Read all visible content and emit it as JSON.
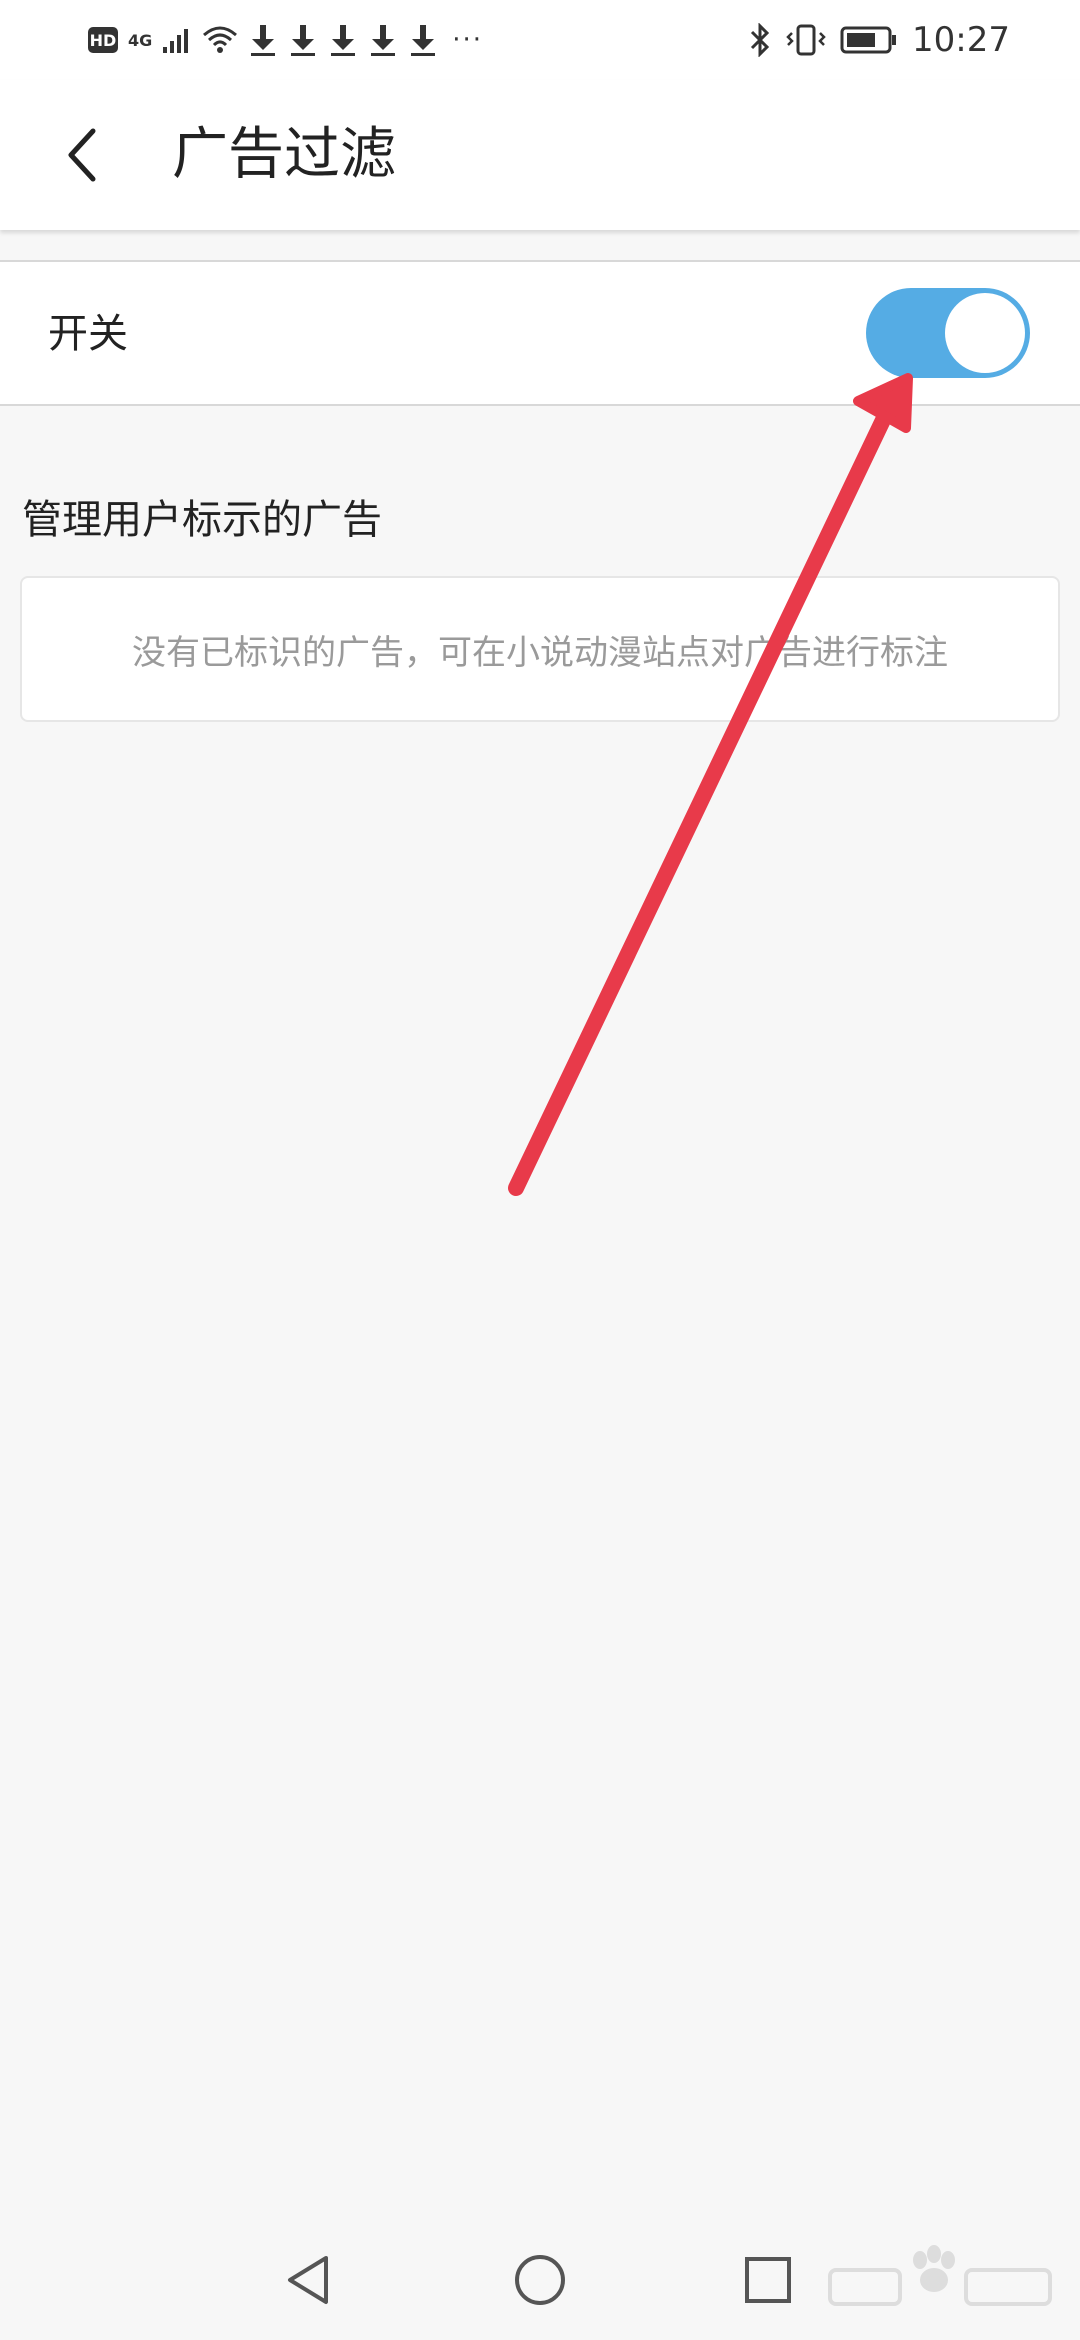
{
  "status_bar": {
    "hd_label": "HD",
    "network_label": "4G",
    "time": "10:27",
    "icons": [
      "hd-icon",
      "signal-icon",
      "wifi-icon",
      "download-icon",
      "download-icon",
      "download-icon",
      "download-icon",
      "download-icon",
      "more-dots-icon",
      "bluetooth-icon",
      "vibrate-icon",
      "battery-icon"
    ]
  },
  "app_bar": {
    "title": "广告过滤",
    "back_icon": "chevron-left-icon"
  },
  "settings": {
    "switch_label": "开关",
    "switch_on": true,
    "accent_color": "#55ace4"
  },
  "user_ads": {
    "section_title": "管理用户标示的广告",
    "empty_message": "没有已标识的广告，可在小说动漫站点对广告进行标注"
  },
  "annotation": {
    "arrow_color": "#e83a4a"
  },
  "nav_bar": {
    "icons": [
      "back-triangle-icon",
      "home-circle-icon",
      "recent-square-icon"
    ]
  }
}
